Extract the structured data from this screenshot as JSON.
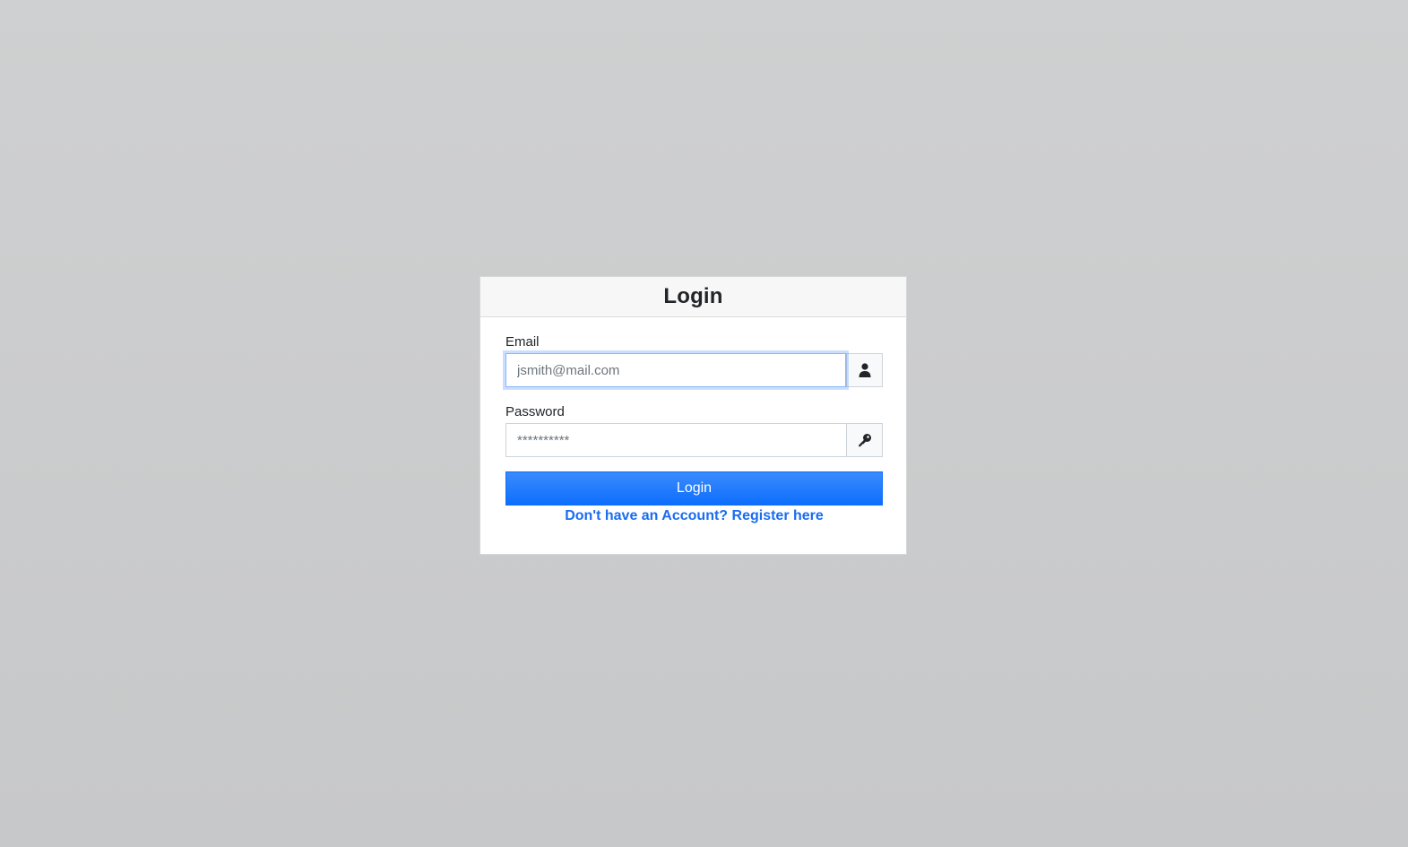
{
  "login_card": {
    "title": "Login",
    "email": {
      "label": "Email",
      "placeholder": "jsmith@mail.com",
      "value": "",
      "icon": "user-icon"
    },
    "password": {
      "label": "Password",
      "placeholder": "**********",
      "value": "",
      "icon": "key-icon"
    },
    "submit_label": "Login",
    "register_link": "Don't have an Account? Register here"
  },
  "colors": {
    "accent": "#0d6efd",
    "link": "#1a6cf0",
    "background": "#cbcccd"
  }
}
